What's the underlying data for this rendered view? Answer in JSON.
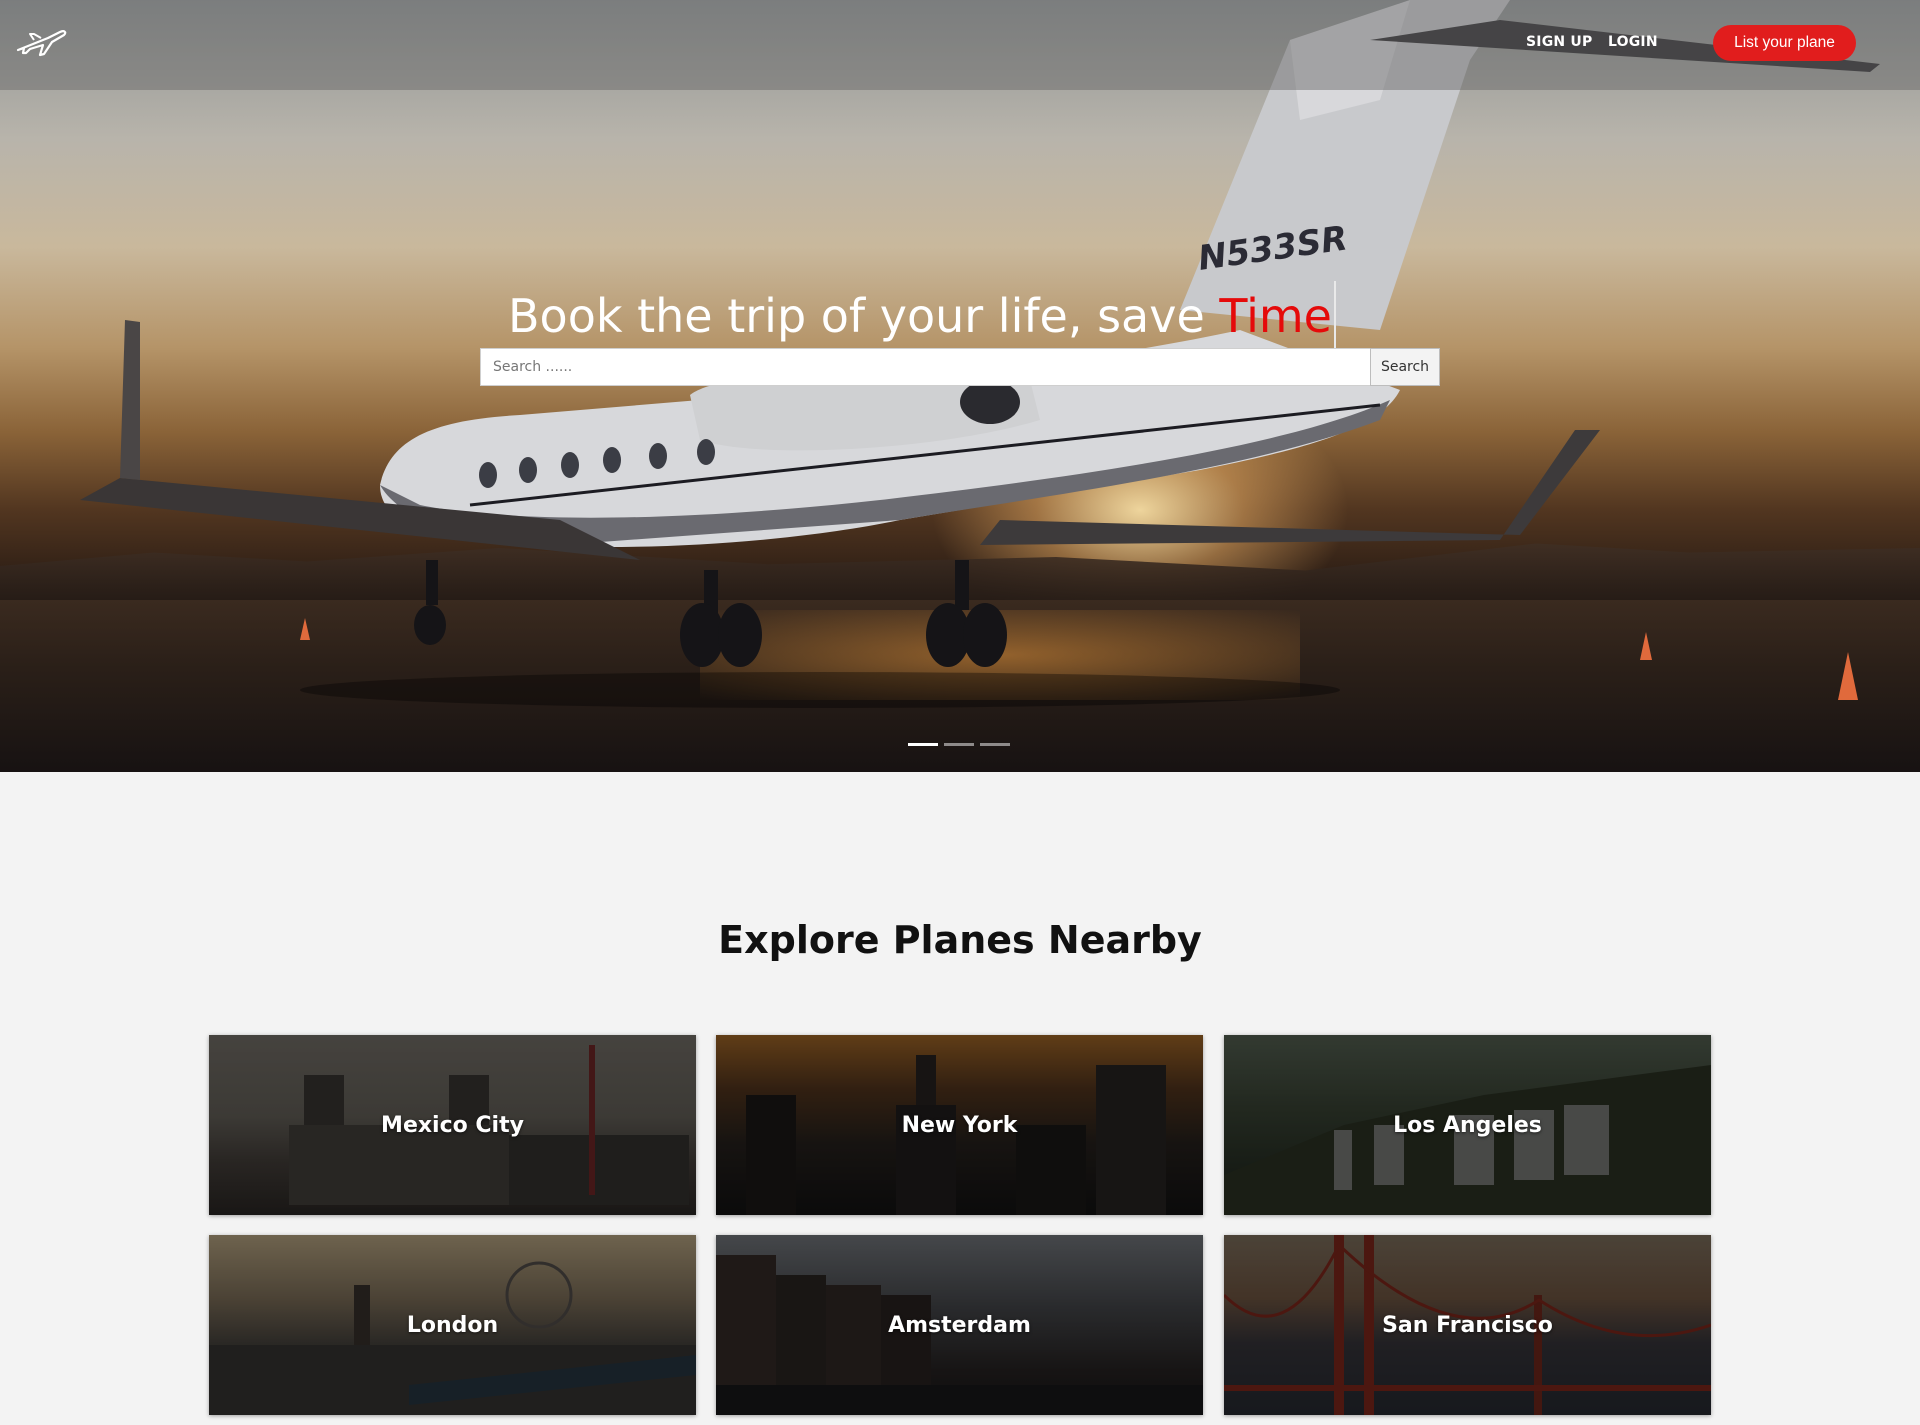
{
  "nav": {
    "logo_icon": "airplane-icon",
    "signup_label": "SIGN UP",
    "login_label": "LOGIN",
    "list_plane_label": "List your plane"
  },
  "hero": {
    "headline_prefix": "Book the trip of your life, save ",
    "headline_accent": "Time",
    "tail_number": "N533SR",
    "search_placeholder": "Search ......",
    "search_button": "Search",
    "slides_total": 3,
    "active_slide": 1
  },
  "explore": {
    "title": "Explore Planes Nearby",
    "cities": [
      {
        "name": "Mexico City"
      },
      {
        "name": "New York"
      },
      {
        "name": "Los Angeles"
      },
      {
        "name": "London"
      },
      {
        "name": "Amsterdam"
      },
      {
        "name": "San Francisco"
      }
    ]
  },
  "colors": {
    "accent_red": "#e11d1d",
    "page_background": "#f3f3f3"
  }
}
